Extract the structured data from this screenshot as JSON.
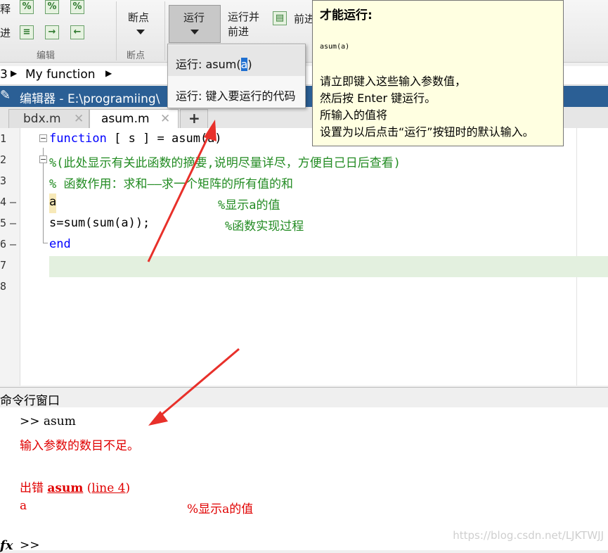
{
  "toolstrip": {
    "left_labels": [
      "释",
      "进"
    ],
    "breakpoint_label": "断点",
    "run_label": "运行",
    "run_advance_label": "运行并\n前进",
    "advance_label": "前进",
    "section_edit": "编辑",
    "section_breakpoints": "断点"
  },
  "breadcrumb": {
    "prefix": "3",
    "item": "My function"
  },
  "editor_window": {
    "title": "编辑器 - E:\\programiing\\"
  },
  "tabs": [
    {
      "label": "bdx.m"
    },
    {
      "label": "asum.m"
    }
  ],
  "editor": {
    "line_numbers": [
      "1",
      "2",
      "3",
      "4",
      "5",
      "6",
      "7",
      "8"
    ],
    "line1_kw": "function",
    "line1_rest": " [ s ] = asum(a)",
    "line2": "%(此处显示有关此函数的摘要,说明尽量详尽，方便自己日后查看)",
    "line3": "% 函数作用：求和——求一个矩阵的所有值的和",
    "line4_code": "a",
    "line4_comment": "%显示a的值",
    "line5_code": "s=sum(sum(a));",
    "line5_comment": "%函数实现过程",
    "line6_kw": "end"
  },
  "run_menu": {
    "item1_prefix": "运行: asum(",
    "item1_selected": "a",
    "item1_suffix": ")",
    "item2": "运行: 键入要运行的代码"
  },
  "tooltip": {
    "title": "才能运行:",
    "example": "asum(a)",
    "line1": "请立即键入这些输入参数值，",
    "line2": "然后按 Enter 键运行。",
    "line3": "所输入的值将",
    "line4": "设置为以后点击“运行”按钮时的默认输入。"
  },
  "command_window": {
    "title": "命令行窗口",
    "prompt_line": ">> asum",
    "error_msg": "输入参数的数目不足。",
    "error_prefix": "出错 ",
    "error_func": "asum",
    "error_open": " (",
    "error_line": "line 4",
    "error_close": ")",
    "error_code": "a",
    "error_comment": "%显示a的值",
    "fx_icon": "fx",
    "final_prompt": ">>"
  },
  "watermark": "https://blog.csdn.net/LJKTWJJ",
  "colors": {
    "keyword": "#0000ff",
    "comment": "#228b22",
    "error": "#e00000",
    "titlebar": "#2b5f95",
    "arrow": "#e8302a"
  }
}
